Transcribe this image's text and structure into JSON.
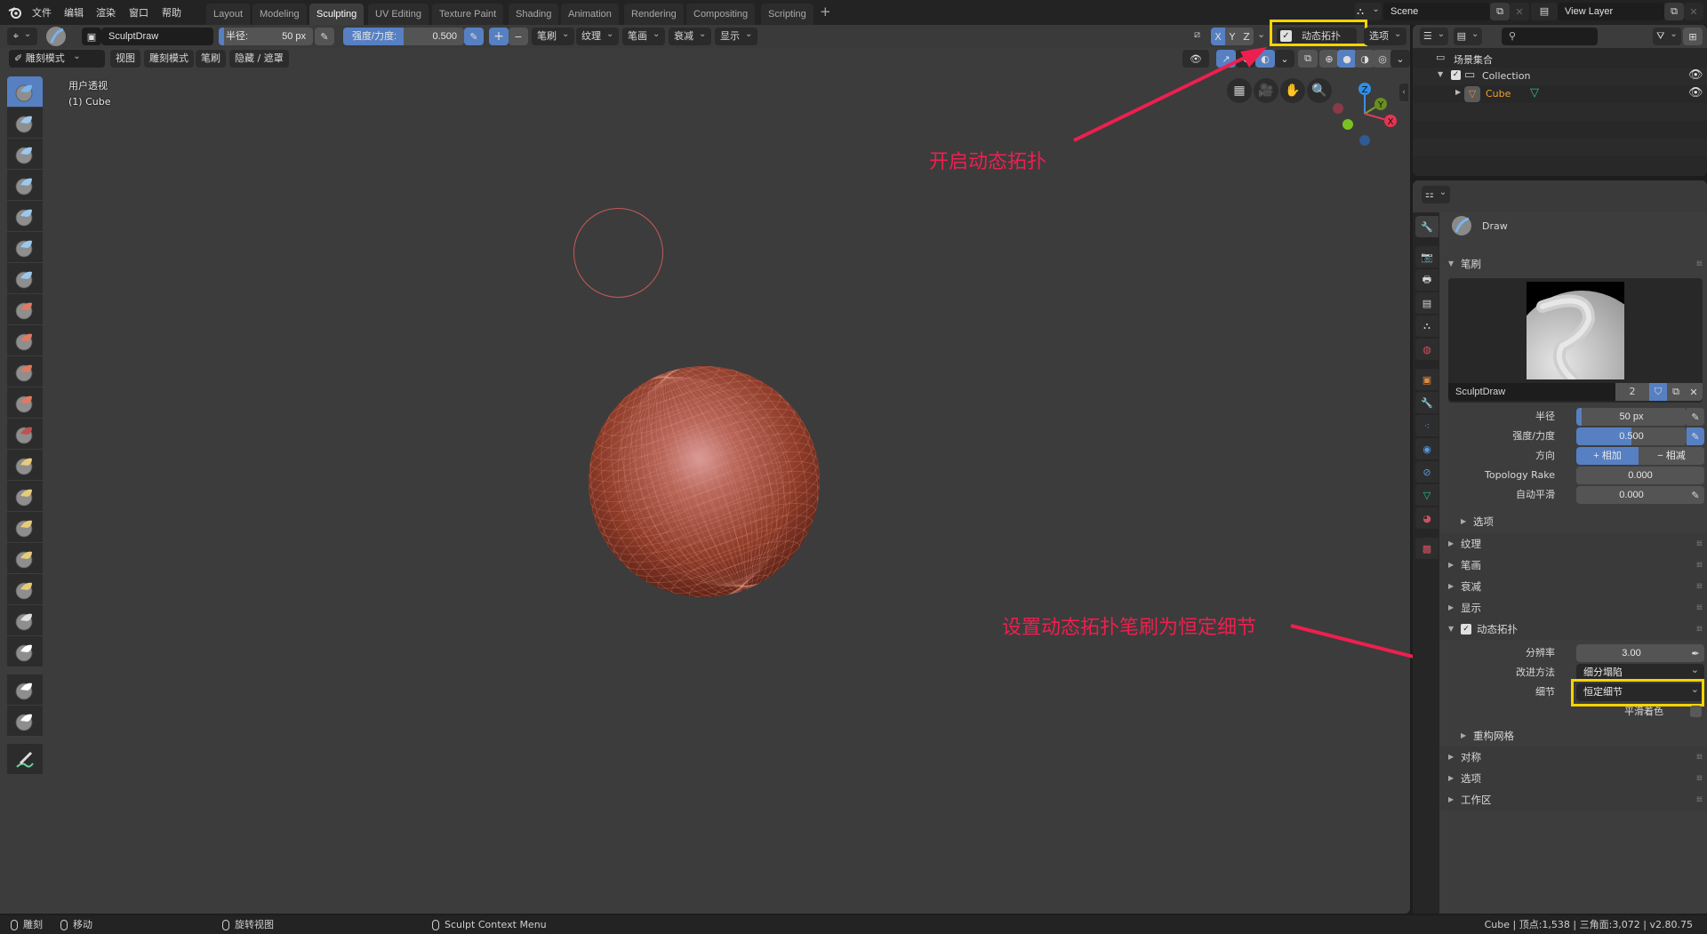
{
  "menu": {
    "items": [
      "文件",
      "编辑",
      "渲染",
      "窗口",
      "帮助"
    ]
  },
  "workspaces": {
    "tabs": [
      "Layout",
      "Modeling",
      "Sculpting",
      "UV Editing",
      "Texture Paint",
      "Shading",
      "Animation",
      "Rendering",
      "Compositing",
      "Scripting"
    ],
    "active": "Sculpting",
    "add_label": "+"
  },
  "scene": {
    "name": "Scene",
    "view_layer": "View Layer"
  },
  "toolbar": {
    "brush_name": "SculptDraw",
    "radius_label": "半径:",
    "radius_value": "50 px",
    "strength_label": "强度/力度:",
    "strength_value": "0.500",
    "plus": "+",
    "minus": "−",
    "menus": [
      "笔刷",
      "纹理",
      "笔画",
      "衰减",
      "显示"
    ],
    "axes": [
      "X",
      "Y",
      "Z"
    ],
    "dyntopo_label": "动态拓扑",
    "dyntopo_checked": true,
    "options_label": "选项"
  },
  "header2": {
    "mode": "雕刻模式",
    "menus": [
      "视图",
      "雕刻模式",
      "笔刷",
      "隐藏 / 遮罩"
    ]
  },
  "viewport": {
    "view_name": "用户透视",
    "object_label": "(1) Cube",
    "gizmo": {
      "x": "X",
      "y": "Y",
      "z": "Z"
    }
  },
  "annotations": {
    "top": "开启动态拓扑",
    "bottom": "设置动态拓扑笔刷为恒定细节",
    "color": "#ee1f4f",
    "highlight_color": "#f5d400"
  },
  "tools": [
    "draw",
    "clay",
    "clay-strips",
    "layer",
    "inflate",
    "blob",
    "crease",
    "smooth",
    "flatten",
    "fill",
    "scrape",
    "pinch",
    "grab",
    "snake-hook",
    "thumb",
    "nudge",
    "rotate",
    "simplify",
    "mask",
    "box-mask",
    "box-hide",
    "annotate"
  ],
  "outliner": {
    "search_placeholder": "",
    "root": "场景集合",
    "collection": "Collection",
    "object": "Cube"
  },
  "properties": {
    "brush_tool_name": "Draw",
    "brush_section": "笔刷",
    "brush_datablock": "SculptDraw",
    "brush_users": "2",
    "radius_label": "半径",
    "radius_value": "50 px",
    "radius_fraction": 0.05,
    "strength_label": "强度/力度",
    "strength_value": "0.500",
    "strength_fraction": 0.5,
    "direction_label": "方向",
    "direction_add": "相加",
    "direction_sub": "相减",
    "topology_rake_label": "Topology Rake",
    "topology_rake_value": "0.000",
    "autosmooth_label": "自动平滑",
    "autosmooth_value": "0.000",
    "options_sub": "选项",
    "sections": [
      "纹理",
      "笔画",
      "衰减",
      "显示"
    ],
    "dyntopo": {
      "title": "动态拓扑",
      "checked": true,
      "resolution_label": "分辨率",
      "resolution_value": "3.00",
      "refine_label": "改进方法",
      "refine_value": "细分塌陷",
      "detail_label": "细节",
      "detail_value": "恒定细节",
      "smooth_shading_label": "平滑着色",
      "remesh": "重构网格"
    },
    "tail_sections": [
      "对称",
      "选项",
      "工作区"
    ]
  },
  "statusbar": {
    "left_click": "雕刻",
    "middle": "移动",
    "rotate": "旋转视图",
    "context": "Sculpt Context Menu",
    "stats": "Cube | 顶点:1,538 | 三角面:3,072 | v2.80.75"
  }
}
